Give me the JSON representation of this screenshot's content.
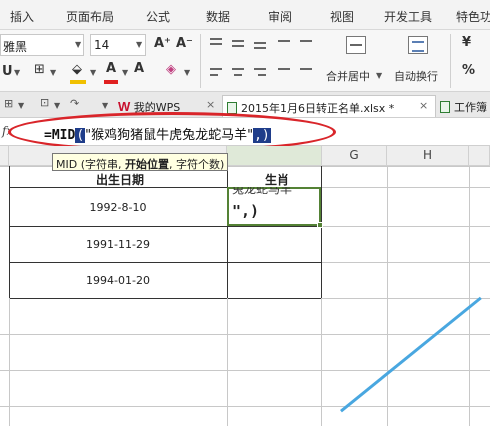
{
  "menu": [
    "插入",
    "页面布局",
    "公式",
    "数据",
    "审阅",
    "视图",
    "开发工具",
    "特色功"
  ],
  "ribbon": {
    "font_name": "雅黑",
    "font_size": "14",
    "font_grow": "A⁺",
    "font_shrink": "A⁻",
    "merge_label": "合并居中",
    "wrap_label": "自动换行",
    "currency_symbol": "¥"
  },
  "tabs": {
    "mywps": "我的WPS",
    "file": "2015年1月6日转正名单.xlsx *",
    "workbook": "工作簿"
  },
  "formula_bar": {
    "fx": "fx",
    "formula_prefix": "=MID",
    "formula_open": "(",
    "formula_string": "\"猴鸡狗猪鼠牛虎兔龙蛇马羊\"",
    "formula_tail": ",)"
  },
  "tooltip": {
    "open": "MID (字符串, ",
    "bold": "开始位置",
    "close": ", 字符个数)"
  },
  "columns": [
    "G",
    "H"
  ],
  "table": {
    "header_birth": "出生日期",
    "header_zodiac": "生肖",
    "rows": [
      "1992-8-10",
      "1991-11-29",
      "1994-01-20"
    ]
  },
  "active_cell": {
    "edit_text": "\",)",
    "overflow_text": "兔龙蛇马羊"
  },
  "colors": {
    "selection_green": "#548235",
    "annotation_red": "#d9252a",
    "wps_red": "#c8102e"
  }
}
